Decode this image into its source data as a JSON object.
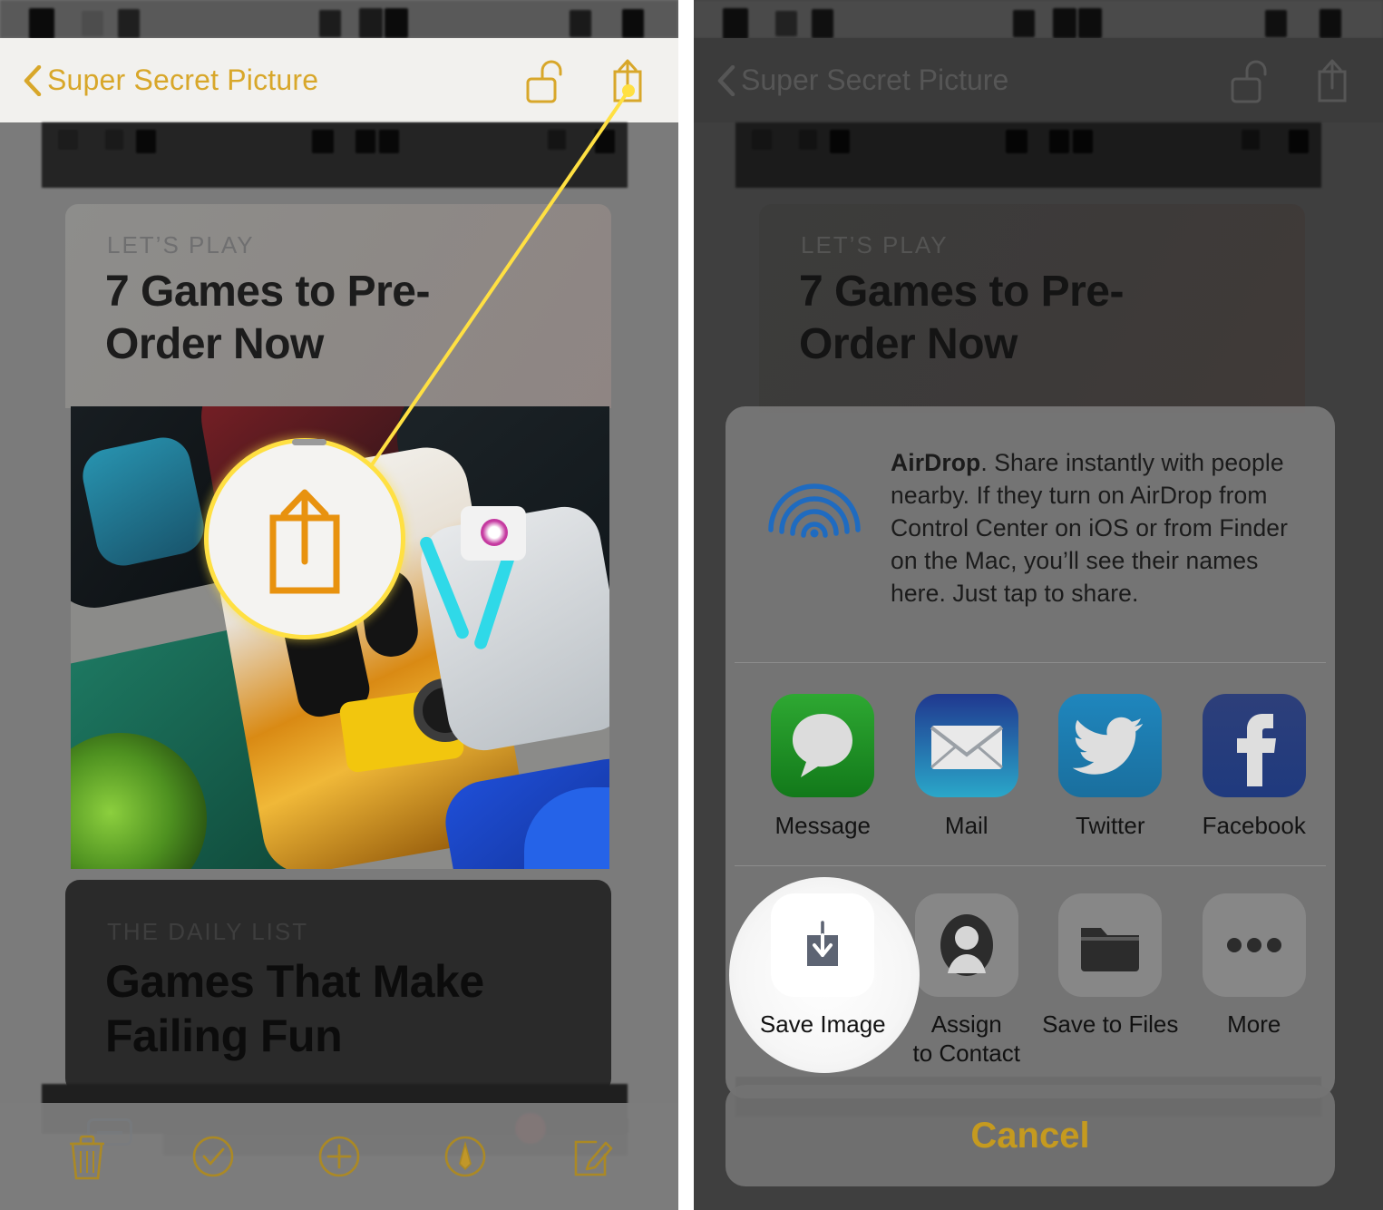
{
  "left_panel": {
    "nav": {
      "back_icon": "chevron-left-icon",
      "title": "Super Secret Picture",
      "lock_icon": "unlocked-lock-icon",
      "share_icon": "share-icon"
    },
    "articles": [
      {
        "kicker": "LET’S PLAY",
        "headline_line1": "7 Games to Pre-",
        "headline_line2": "Order Now"
      },
      {
        "kicker": "THE DAILY LIST",
        "headline_line1": "Games That Make",
        "headline_line2": "Failing Fun"
      }
    ],
    "toolbar": [
      {
        "name": "trash-icon",
        "label": "Delete"
      },
      {
        "name": "checkmark-circle-icon",
        "label": "Select"
      },
      {
        "name": "plus-circle-icon",
        "label": "Add"
      },
      {
        "name": "markup-pen-circle-icon",
        "label": "Markup"
      },
      {
        "name": "compose-icon",
        "label": "Edit"
      }
    ],
    "callout": {
      "target_icon": "share-icon",
      "description": "Yellow line pointing from the share button to a magnified spotlight circle"
    }
  },
  "right_panel": {
    "nav": {
      "back_icon": "chevron-left-icon",
      "title": "Super Secret Picture",
      "lock_icon": "unlocked-lock-icon",
      "share_icon": "share-icon"
    },
    "article": {
      "kicker": "LET’S PLAY",
      "headline_line1": "7 Games to Pre-",
      "headline_line2": "Order Now"
    },
    "share_sheet": {
      "airdrop": {
        "icon": "airdrop-icon",
        "title": "AirDrop",
        "body": ". Share instantly with people nearby. If they turn on AirDrop from Control Center on iOS or from Finder on the Mac, you’ll see their names here. Just tap to share."
      },
      "apps": [
        {
          "label": "Message",
          "icon": "messages-app-icon",
          "color": "#1f8a28"
        },
        {
          "label": "Mail",
          "icon": "mail-app-icon",
          "color": "#2079c8"
        },
        {
          "label": "Twitter",
          "icon": "twitter-app-icon",
          "color": "#1d7fb5"
        },
        {
          "label": "Facebook",
          "icon": "facebook-app-icon",
          "color": "#2b4a8b"
        }
      ],
      "actions": [
        {
          "label": "Save Image",
          "label_line2": "",
          "icon": "save-image-icon",
          "highlighted": true
        },
        {
          "label": "Assign",
          "label_line2": "to Contact",
          "icon": "contact-person-icon",
          "highlighted": false
        },
        {
          "label": "Save to Files",
          "label_line2": "",
          "icon": "folder-icon",
          "highlighted": false
        },
        {
          "label": "More",
          "label_line2": "",
          "icon": "ellipsis-icon",
          "highlighted": false
        }
      ],
      "cancel_label": "Cancel"
    }
  },
  "colors": {
    "accent_gold": "#d8a72a",
    "callout_yellow": "#ffe042",
    "cancel_gold": "#c59a1f",
    "airdrop_blue": "#1f6bc0"
  }
}
